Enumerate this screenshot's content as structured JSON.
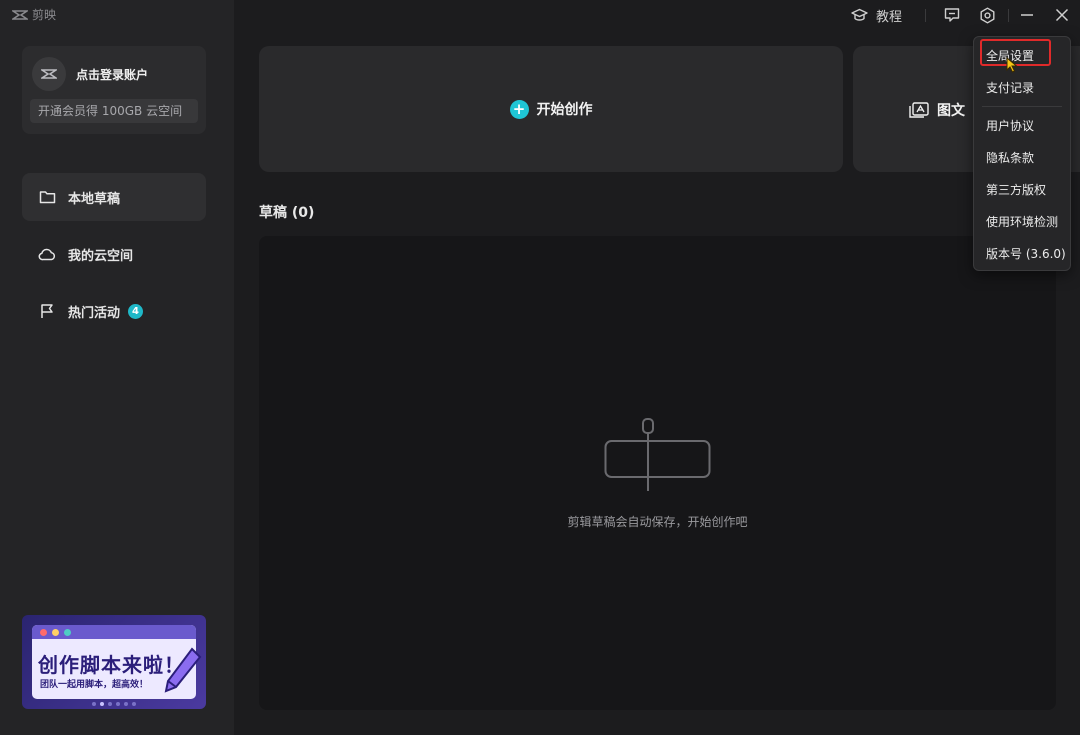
{
  "app": {
    "name": "剪映"
  },
  "account": {
    "login_label": "点击登录账户",
    "member_promo": "开通会员得 100GB 云空间"
  },
  "sidebar": {
    "items": [
      {
        "label": "本地草稿",
        "icon": "folder-icon",
        "active": true
      },
      {
        "label": "我的云空间",
        "icon": "cloud-icon"
      },
      {
        "label": "热门活动",
        "icon": "flag-icon",
        "badge": "4"
      }
    ]
  },
  "banner": {
    "title": "创作脚本来啦！",
    "subtitle": "团队一起用脚本，超高效！"
  },
  "topbar": {
    "tutorial_label": "教程"
  },
  "main": {
    "start_label": "开始创作",
    "image_text_label": "图文",
    "drafts_title": "草稿 (0)",
    "empty_message": "剪辑草稿会自动保存，开始创作吧"
  },
  "settings_menu": {
    "items": [
      "全局设置",
      "支付记录",
      "用户协议",
      "隐私条款",
      "第三方版权",
      "使用环境检测",
      "版本号 (3.6.0)"
    ]
  },
  "colors": {
    "accent": "#1fc6d6",
    "highlight_border": "#e02a2a",
    "background": "#1c1c1e",
    "sidebar": "#242426"
  }
}
